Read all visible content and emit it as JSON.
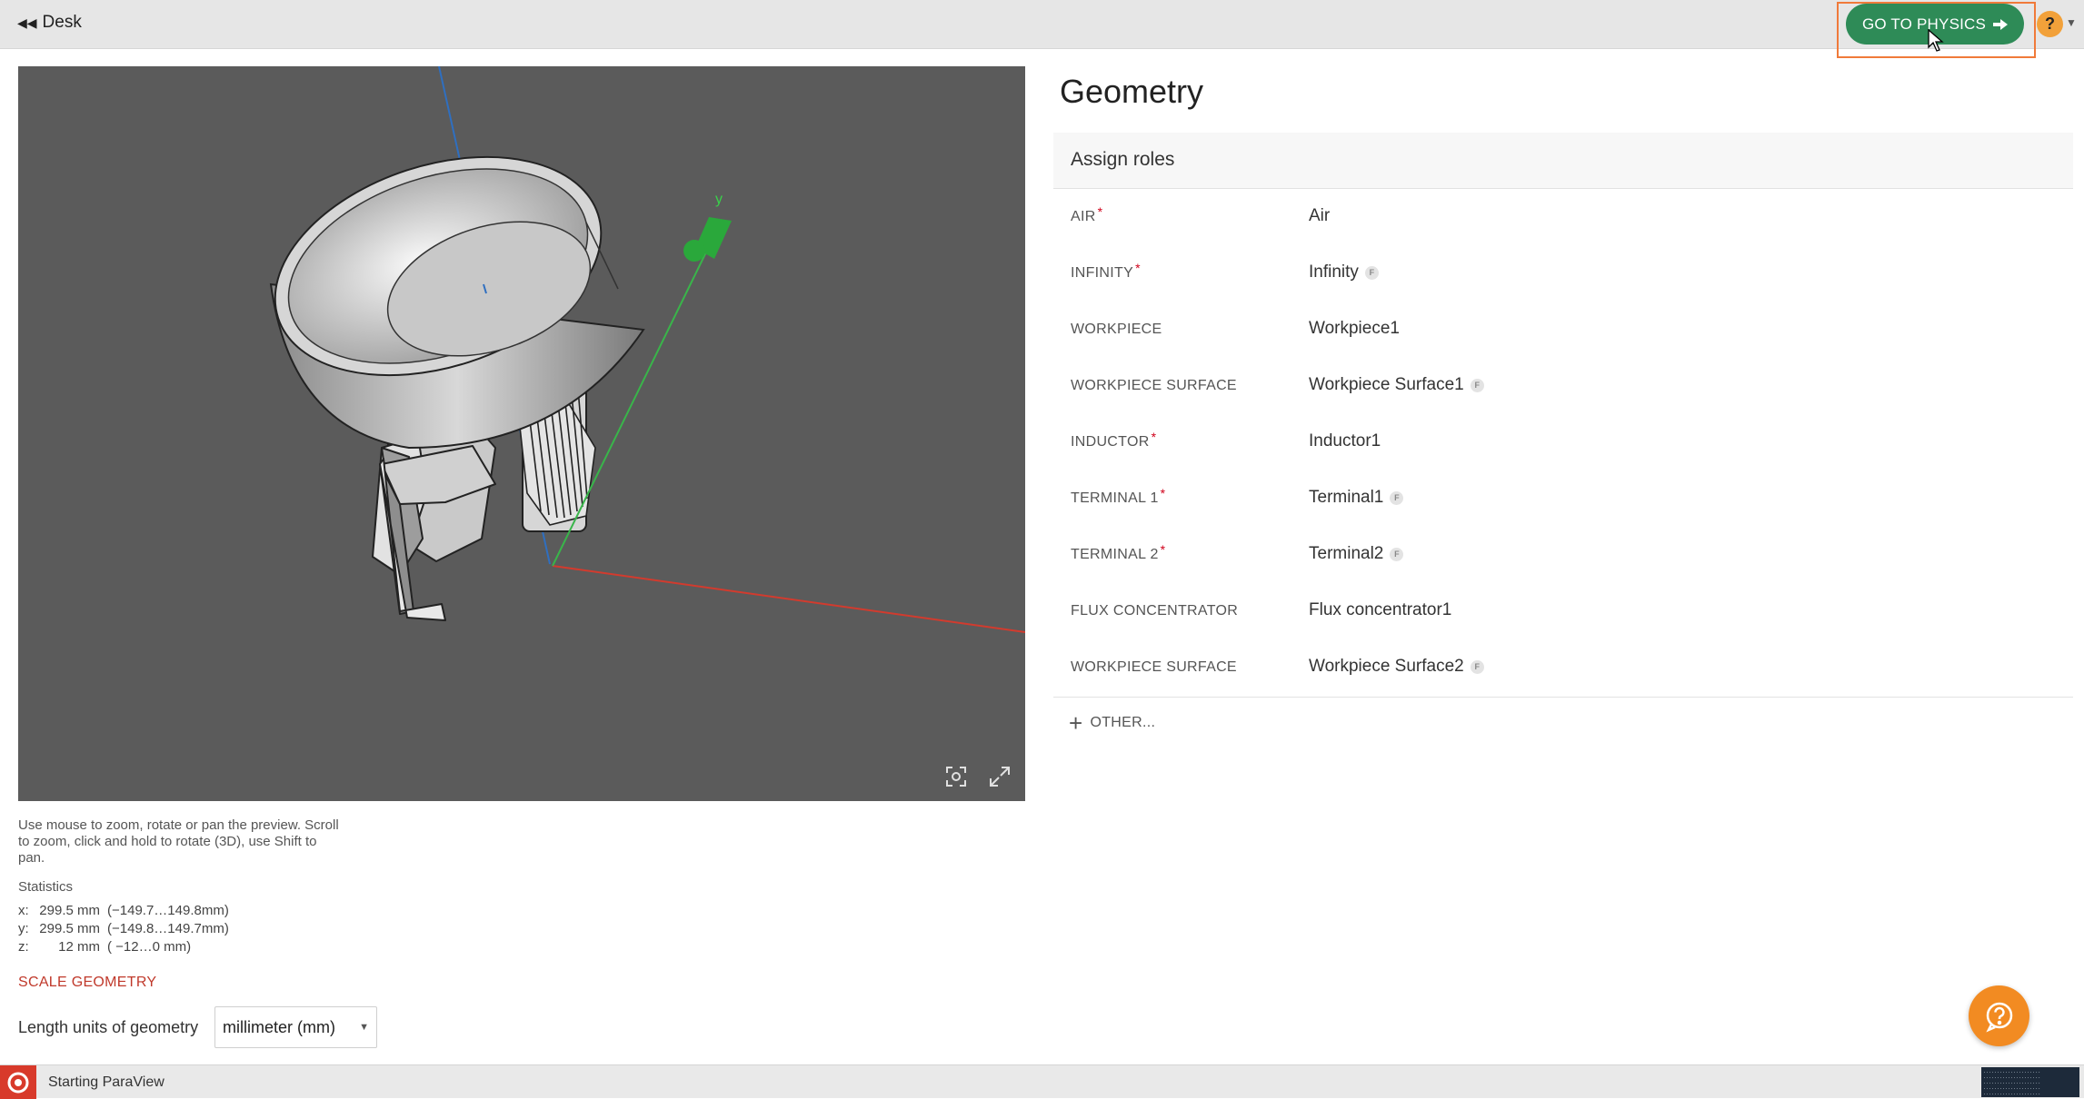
{
  "topbar": {
    "back_label": "Desk",
    "goto_physics_label": "GO TO PHYSICS",
    "help_label": "?"
  },
  "viewport": {
    "axis_label_y": "y"
  },
  "left_panel": {
    "hint": "Use mouse to zoom, rotate or pan the preview. Scroll to zoom, click and hold to rotate (3D), use Shift to pan.",
    "stats_title": "Statistics",
    "stats": [
      {
        "axis": "x:",
        "length": "299.5 mm",
        "range": "(−149.7…149.8mm)"
      },
      {
        "axis": "y:",
        "length": "299.5 mm",
        "range": "(−149.8…149.7mm)"
      },
      {
        "axis": "z:",
        "length": "12 mm",
        "range": "( −12…0 mm)"
      }
    ],
    "scale_geometry_label": "SCALE GEOMETRY",
    "units_label": "Length units of geometry",
    "units_value": "millimeter (mm)"
  },
  "right_panel": {
    "title": "Geometry",
    "section_title": "Assign roles",
    "roles": [
      {
        "key": "AIR",
        "required": "*",
        "value": "Air",
        "badge": ""
      },
      {
        "key": "INFINITY",
        "required": "*",
        "value": "Infinity",
        "badge": "F"
      },
      {
        "key": "WORKPIECE",
        "required": "",
        "value": "Workpiece1",
        "badge": ""
      },
      {
        "key": "WORKPIECE SURFACE",
        "required": "",
        "value": "Workpiece Surface1",
        "badge": "F"
      },
      {
        "key": "INDUCTOR",
        "required": "*",
        "value": "Inductor1",
        "badge": ""
      },
      {
        "key": "TERMINAL 1",
        "required": "*",
        "value": "Terminal1",
        "badge": "F"
      },
      {
        "key": "TERMINAL 2",
        "required": "*",
        "value": "Terminal2",
        "badge": "F"
      },
      {
        "key": "FLUX CONCENTRATOR",
        "required": "",
        "value": "Flux concentrator1",
        "badge": ""
      },
      {
        "key": "WORKPIECE SURFACE",
        "required": "",
        "value": "Workpiece Surface2",
        "badge": "F"
      }
    ],
    "other_label": "OTHER..."
  },
  "statusbar": {
    "text": "Starting ParaView"
  },
  "colors": {
    "accent_green": "#2e8b57",
    "accent_orange": "#f28b22",
    "required_red": "#d0021b"
  }
}
